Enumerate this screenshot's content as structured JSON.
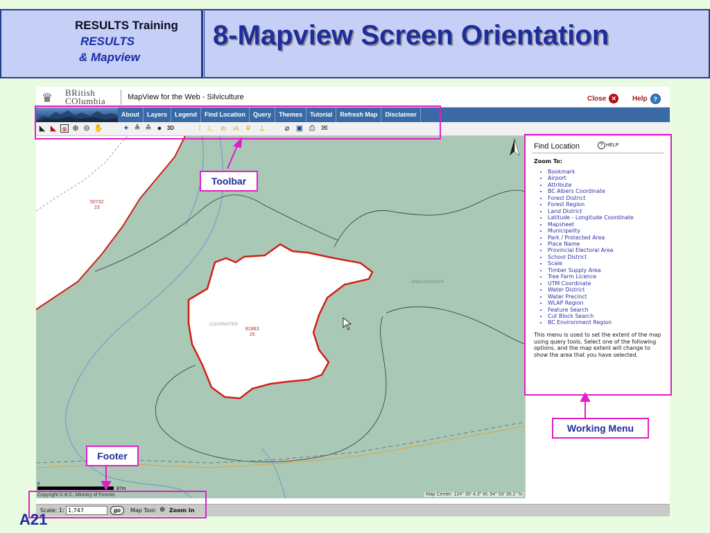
{
  "slide": {
    "header_line1": "RESULTS Training",
    "header_line2": "RESULTS",
    "header_line3": "& Mapview",
    "title": "8-Mapview Screen Orientation",
    "page_number": "A21"
  },
  "app": {
    "org_logo_text": "BRITISH COLUMBIA",
    "title": "MapView for the Web - Silviculture",
    "close_label": "Close",
    "help_label": "Help",
    "menu": [
      "About",
      "Layers",
      "Legend",
      "Find Location",
      "Query",
      "Themes",
      "Tutorial",
      "Refresh Map",
      "Disclaimer"
    ],
    "toolbar_icons": [
      "zoom-full-icon",
      "zoom-previous-icon",
      "zoom-box-icon",
      "zoom-in-icon",
      "zoom-out-icon",
      "pan-icon",
      "identify-icon",
      "layers-icon",
      "map-stack-icon",
      "info-icon",
      "3d-icon",
      "measure-icon",
      "label-icon",
      "label-bold-icon",
      "label-text-icon",
      "grid-icon",
      "ruler-icon",
      "eraser-icon",
      "save-icon",
      "print-icon",
      "email-icon"
    ]
  },
  "map": {
    "labels": {
      "parcel_top_left": "50732\n23",
      "parcel_center": "81883\n25",
      "faint_center": "CLEARWATER",
      "faint_right": "ENGLISHMAN-R"
    },
    "map_center": "Map Center: 124° 30' 4.3\" W, 54° 53' 30.1\" N",
    "scale_zero": "0",
    "scale_end": "87m",
    "copyright": "Copyright © B.C. Ministry of Forests"
  },
  "find_location": {
    "title": "Find Location",
    "help_label": "HELP",
    "zoom_to_label": "Zoom To:",
    "items": [
      "Bookmark",
      "Airport",
      "Attribute",
      "BC Albers Coordinate",
      "Forest District",
      "Forest Region",
      "Land District",
      "Latitude - Longitude Coordinate",
      "Mapsheet",
      "Municipality",
      "Park / Protected Area",
      "Place Name",
      "Provincial Electoral Area",
      "School District",
      "Scale",
      "Timber Supply Area",
      "Tree Farm Licence",
      "UTM Coordinate",
      "Water District",
      "Water Precinct",
      "WLAP Region",
      "Feature Search",
      "Cut Block Search",
      "BC Environment Region"
    ],
    "description": "This menu is used to set the extent of the map using query tools. Select one of the following options, and the map extent will change to show the area that you have selected."
  },
  "footer": {
    "scale_label": "Scale: 1:",
    "scale_value": "1,747",
    "go_label": "go",
    "map_tool_label": "Map Tool:",
    "map_tool_value": "Zoom In"
  },
  "annotations": {
    "toolbar": "Toolbar",
    "working_menu": "Working Menu",
    "footer": "Footer"
  },
  "colors": {
    "annotation": "#e31cc7",
    "title_blue": "#1d2d9c",
    "header_bg": "#c6d0f6",
    "slide_bg": "#e9fbe1",
    "map_green": "#a9c9b6",
    "cutblock_red": "#d01f17",
    "menubar_blue": "#3a6aa5"
  }
}
